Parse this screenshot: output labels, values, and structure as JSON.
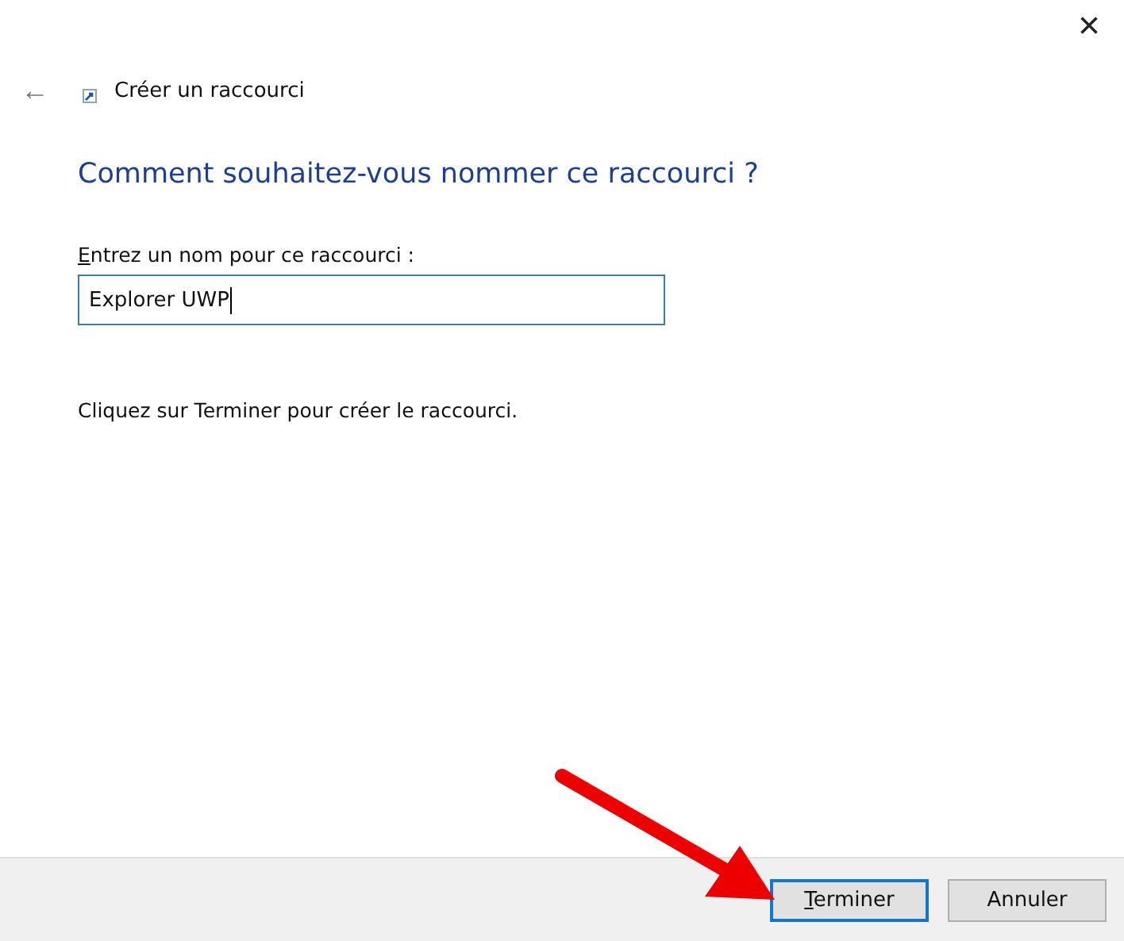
{
  "window": {
    "close": "×"
  },
  "header": {
    "back": "←",
    "title": "Créer un raccourci"
  },
  "heading": "Comment souhaitez-vous nommer ce raccourci ?",
  "name_field": {
    "label": "Entrez un nom pour ce raccourci :",
    "value": "Explorer UWP"
  },
  "instruction": "Cliquez sur Terminer pour créer le raccourci.",
  "buttons": [
    {
      "label": "Terminer",
      "kind": "default"
    },
    {
      "label": "Annuler",
      "kind": "normal"
    }
  ]
}
